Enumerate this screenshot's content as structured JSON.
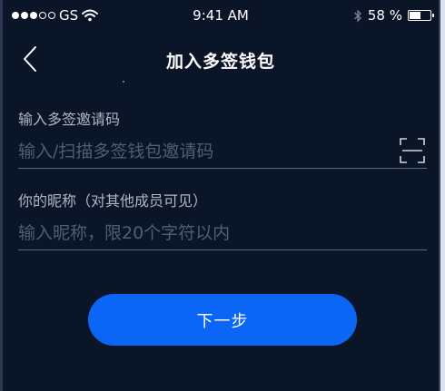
{
  "status_bar": {
    "carrier": "GS",
    "time": "9:41 AM",
    "battery_text": "58 %",
    "battery_level": 0.58,
    "signal_strength": 3,
    "signal_total": 5
  },
  "nav": {
    "title": "加入多签钱包"
  },
  "form": {
    "invite": {
      "label": "输入多签邀请码",
      "placeholder": "输入/扫描多签钱包邀请码",
      "value": ""
    },
    "nickname": {
      "label": "你的昵称（对其他成员可见）",
      "placeholder": "输入昵称，限20个字符以内",
      "value": ""
    }
  },
  "actions": {
    "next_label": "下一步"
  },
  "colors": {
    "background": "#0b1528",
    "primary": "#0c66f5",
    "label": "#aeb7c8",
    "placeholder": "#505d75",
    "divider": "#5c6880"
  }
}
